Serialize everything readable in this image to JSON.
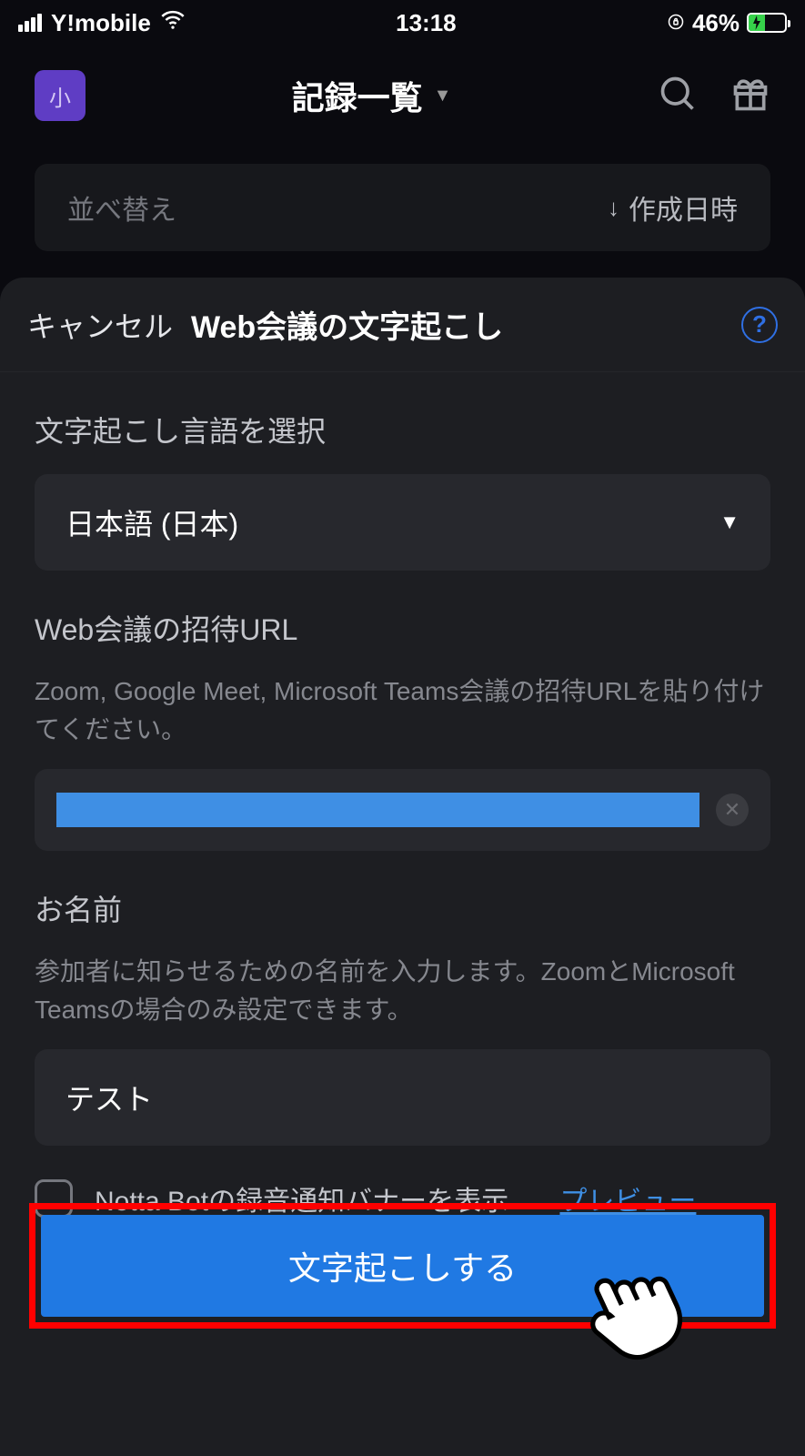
{
  "status_bar": {
    "carrier": "Y!mobile",
    "time": "13:18",
    "battery_percent": "46%"
  },
  "app_header": {
    "avatar_label": "小",
    "title": "記録一覧"
  },
  "sort_bar": {
    "label": "並べ替え",
    "value": "作成日時"
  },
  "sheet": {
    "header": {
      "cancel": "キャンセル",
      "title": "Web会議の文字起こし"
    },
    "language": {
      "label": "文字起こし言語を選択",
      "value": "日本語 (日本)"
    },
    "url": {
      "label": "Web会議の招待URL",
      "desc": "Zoom, Google Meet, Microsoft Teams会議の招待URLを貼り付けてください。"
    },
    "name": {
      "label": "お名前",
      "desc": "参加者に知らせるための名前を入力します。ZoomとMicrosoft Teamsの場合のみ設定できます。",
      "value": "テスト"
    },
    "banner": {
      "label": "Notta Botの録音通知バナーを表示",
      "preview": "プレビュー"
    },
    "submit": "文字起こしする"
  }
}
